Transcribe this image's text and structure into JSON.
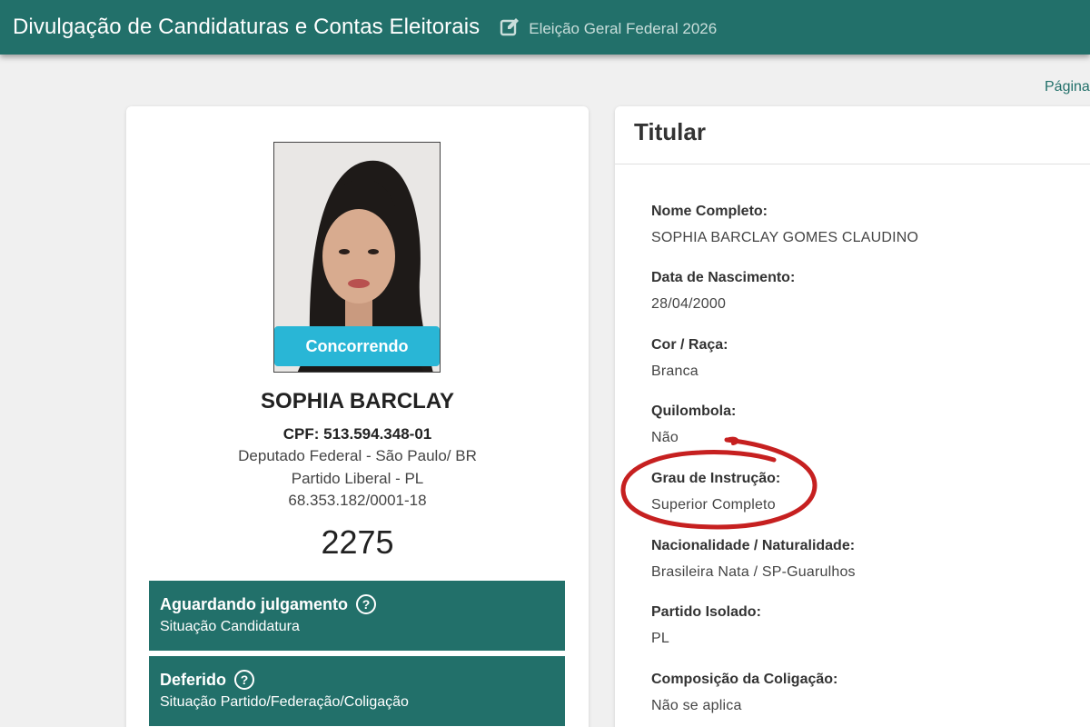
{
  "header": {
    "title": "Divulgação de Candidaturas e Contas Eleitorais",
    "election": "Eleição Geral Federal 2026",
    "icon": "edit-icon"
  },
  "page_link": "Página",
  "candidate": {
    "status_tag": "Concorrendo",
    "name": "SOPHIA BARCLAY",
    "cpf": "CPF: 513.594.348-01",
    "office": "Deputado Federal - São Paulo/ BR",
    "party": "Partido Liberal - PL",
    "cnpj": "68.353.182/0001-18",
    "number": "2275",
    "status_boxes": [
      {
        "title": "Aguardando julgamento",
        "subtitle": "Situação Candidatura"
      },
      {
        "title": "Deferido",
        "subtitle": "Situação Partido/Federação/Coligação"
      }
    ]
  },
  "details": {
    "title": "Titular",
    "fields": [
      {
        "label": "Nome Completo:",
        "value": "SOPHIA BARCLAY GOMES CLAUDINO"
      },
      {
        "label": "Data de Nascimento:",
        "value": "28/04/2000"
      },
      {
        "label": "Cor / Raça:",
        "value": "Branca"
      },
      {
        "label": "Quilombola:",
        "value": "Não"
      },
      {
        "label": "Grau de Instrução:",
        "value": "Superior Completo"
      },
      {
        "label": "Nacionalidade / Naturalidade:",
        "value": "Brasileira Nata / SP-Guarulhos"
      },
      {
        "label": "Partido Isolado:",
        "value": "PL"
      },
      {
        "label": "Composição da Coligação:",
        "value": "Não se aplica"
      }
    ]
  },
  "colors": {
    "header_bg": "#22706a",
    "status_box_bg": "#22706a",
    "status_tag_bg": "#29b6d6",
    "annotation_red": "#c62020"
  }
}
